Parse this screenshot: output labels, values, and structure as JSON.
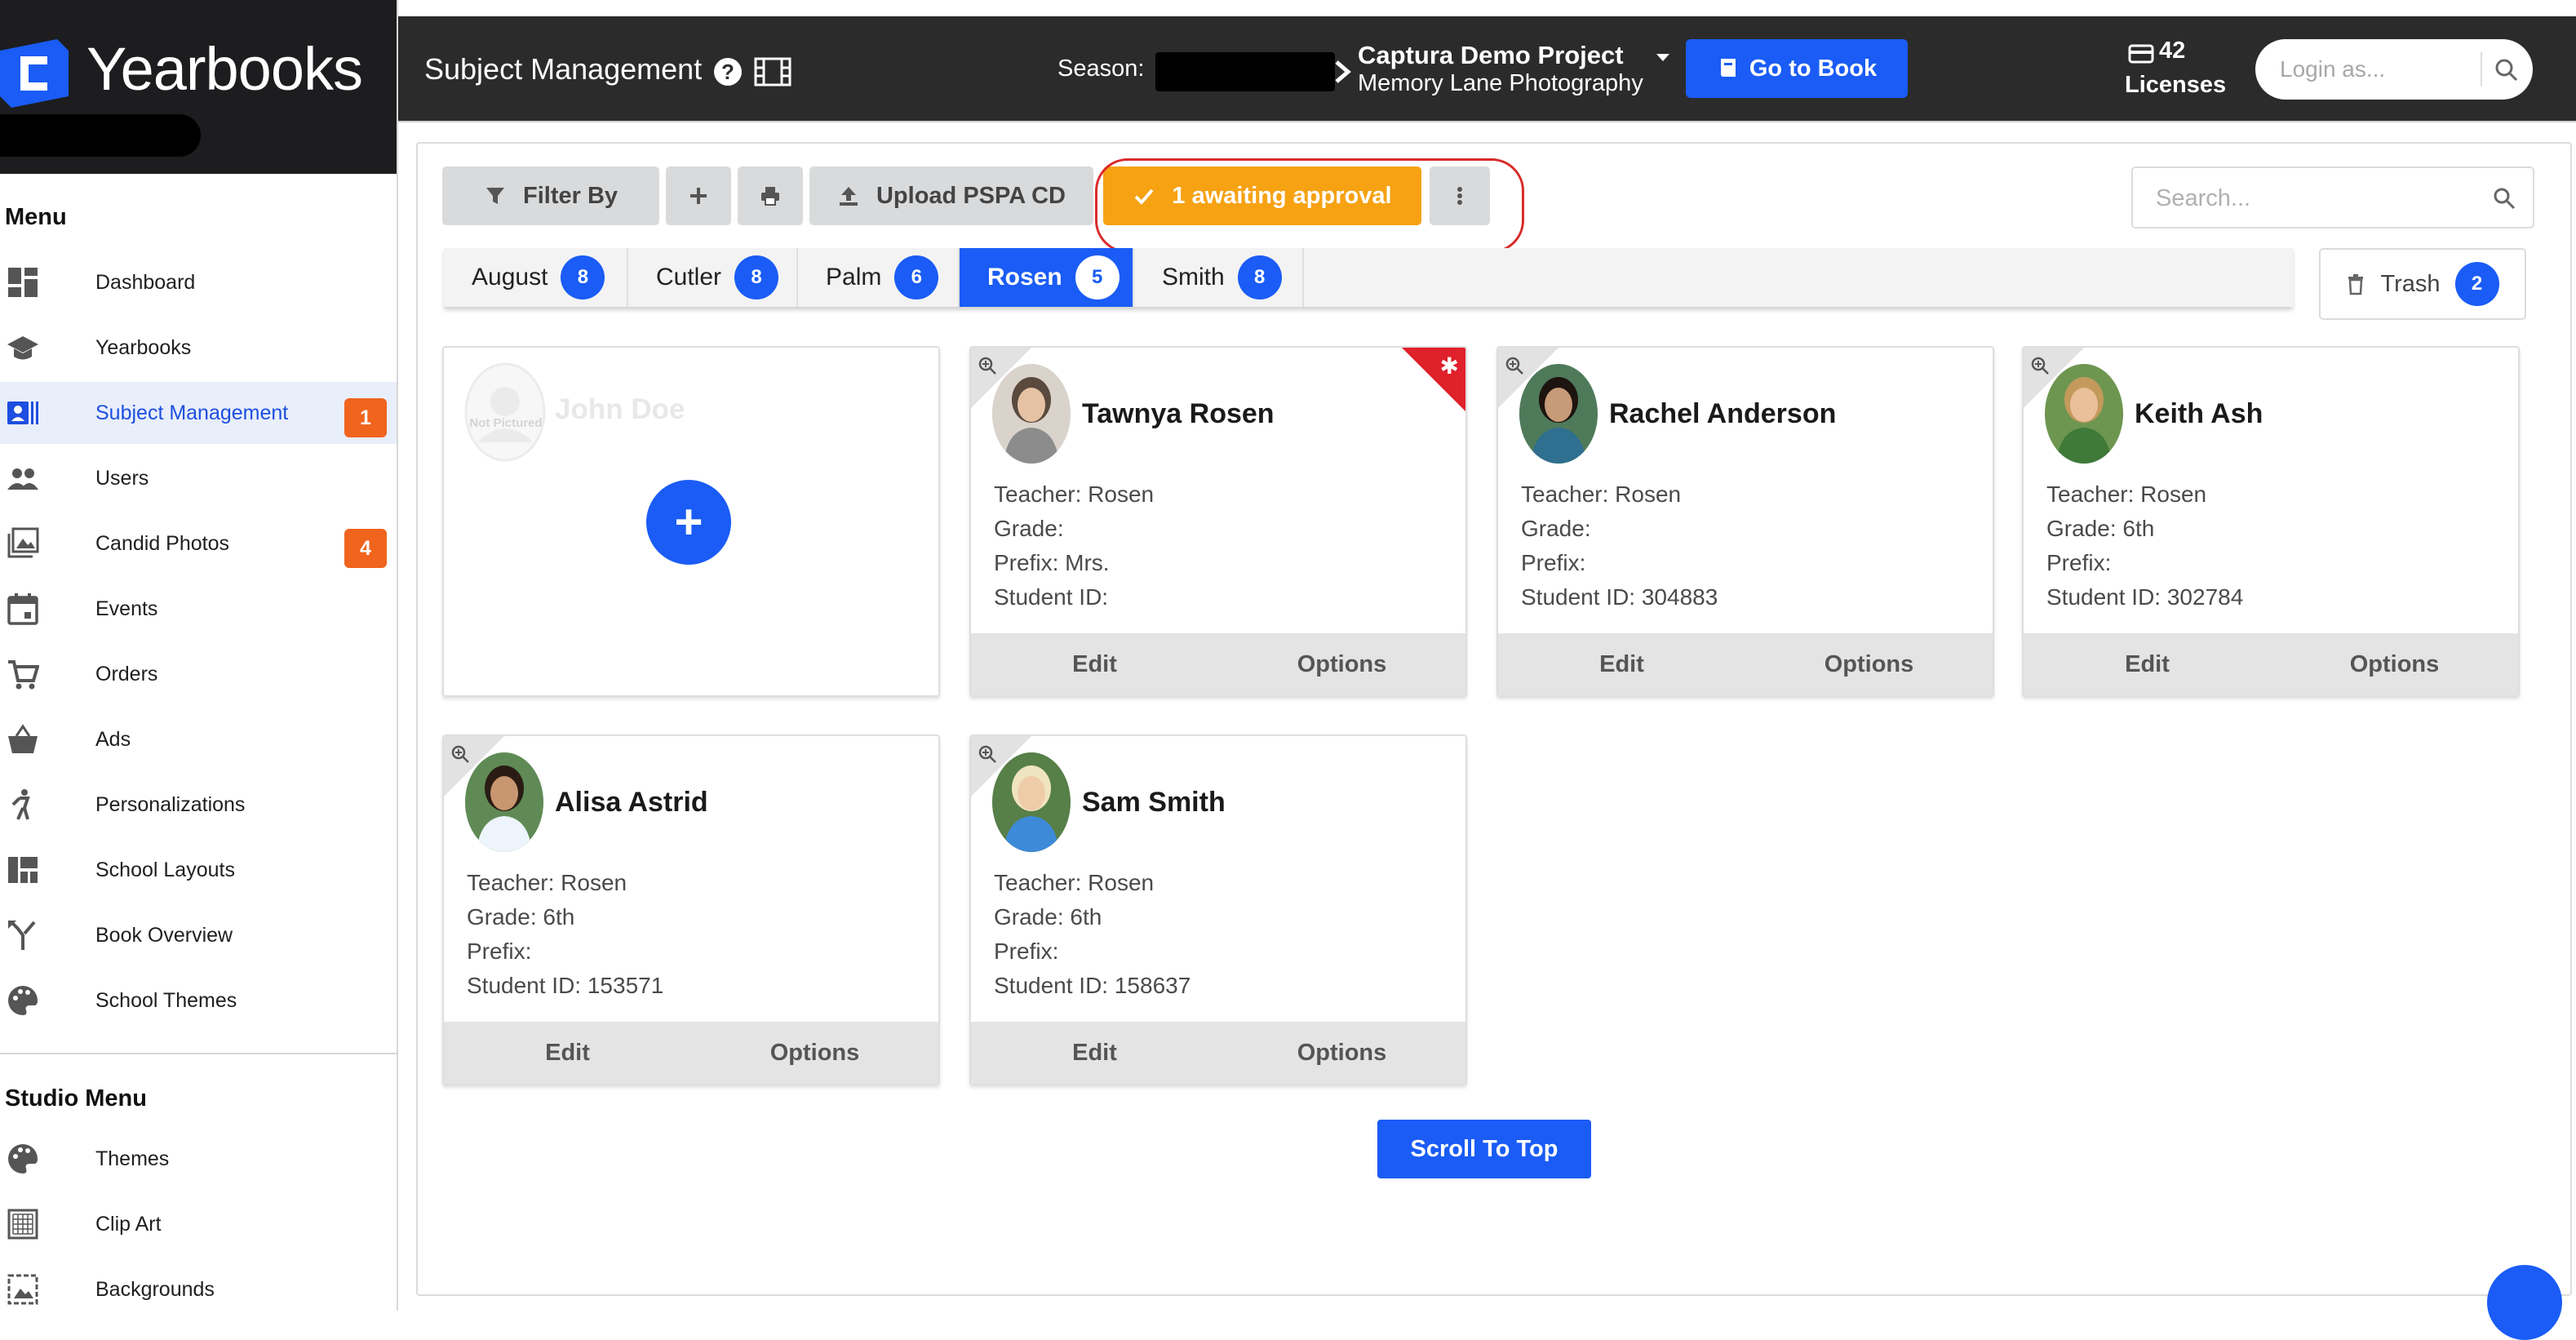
{
  "app": {
    "brand": "Yearbooks"
  },
  "sidebar": {
    "menu_title": "Menu",
    "studio_title": "Studio Menu",
    "items": [
      {
        "label": "Dashboard",
        "icon": "dashboard-icon"
      },
      {
        "label": "Yearbooks",
        "icon": "graduation-cap-icon"
      },
      {
        "label": "Subject Management",
        "icon": "id-card-icon",
        "badge": "1",
        "active": true
      },
      {
        "label": "Users",
        "icon": "users-icon"
      },
      {
        "label": "Candid Photos",
        "icon": "photos-icon",
        "badge": "4"
      },
      {
        "label": "Events",
        "icon": "calendar-icon"
      },
      {
        "label": "Orders",
        "icon": "cart-icon"
      },
      {
        "label": "Ads",
        "icon": "basket-icon"
      },
      {
        "label": "Personalizations",
        "icon": "person-icon"
      },
      {
        "label": "School Layouts",
        "icon": "layout-icon"
      },
      {
        "label": "Book Overview",
        "icon": "fork-icon"
      },
      {
        "label": "School Themes",
        "icon": "palette-icon"
      }
    ],
    "studio_items": [
      {
        "label": "Themes",
        "icon": "palette-icon"
      },
      {
        "label": "Clip Art",
        "icon": "clipart-icon"
      },
      {
        "label": "Backgrounds",
        "icon": "image-icon"
      }
    ]
  },
  "header": {
    "title": "Subject Management",
    "season_label": "Season:",
    "project_name": "Captura Demo Project",
    "project_studio": "Memory Lane Photography",
    "go_to_book": "Go to Book",
    "license_count": "42",
    "license_label": "Licenses",
    "login_placeholder": "Login as..."
  },
  "toolbar": {
    "filter_label": "Filter By",
    "upload_label": "Upload PSPA CD",
    "approval_label": "1 awaiting approval",
    "search_placeholder": "Search..."
  },
  "tabs": [
    {
      "label": "August",
      "count": "8"
    },
    {
      "label": "Cutler",
      "count": "8"
    },
    {
      "label": "Palm",
      "count": "6"
    },
    {
      "label": "Rosen",
      "count": "5",
      "active": true
    },
    {
      "label": "Smith",
      "count": "8"
    }
  ],
  "trash": {
    "label": "Trash",
    "count": "2"
  },
  "add_card": {
    "name": "John Doe",
    "placeholder_text": "Not Pictured"
  },
  "labels": {
    "teacher": "Teacher:",
    "grade": "Grade:",
    "prefix": "Prefix:",
    "student_id": "Student ID:",
    "edit": "Edit",
    "options": "Options"
  },
  "students": [
    {
      "name": "Tawnya Rosen",
      "teacher": "Rosen",
      "grade": "",
      "prefix": "Mrs.",
      "student_id": "",
      "flagged": true,
      "photo": "teacher"
    },
    {
      "name": "Rachel Anderson",
      "teacher": "Rosen",
      "grade": "",
      "prefix": "",
      "student_id": "304883",
      "photo": "girl-dark"
    },
    {
      "name": "Keith Ash",
      "teacher": "Rosen",
      "grade": "6th",
      "prefix": "",
      "student_id": "302784",
      "photo": "boy-green"
    },
    {
      "name": "Alisa Astrid",
      "teacher": "Rosen",
      "grade": "6th",
      "prefix": "",
      "student_id": "153571",
      "photo": "girl-dress"
    },
    {
      "name": "Sam Smith",
      "teacher": "Rosen",
      "grade": "6th",
      "prefix": "",
      "student_id": "158637",
      "photo": "boy-blue"
    }
  ],
  "scroll_to_top": "Scroll To Top",
  "colors": {
    "primary": "#1a5cf5",
    "warning": "#f6a213",
    "badge": "#f0641e",
    "topbar": "#2b2b2b",
    "flag": "#e0202b"
  }
}
